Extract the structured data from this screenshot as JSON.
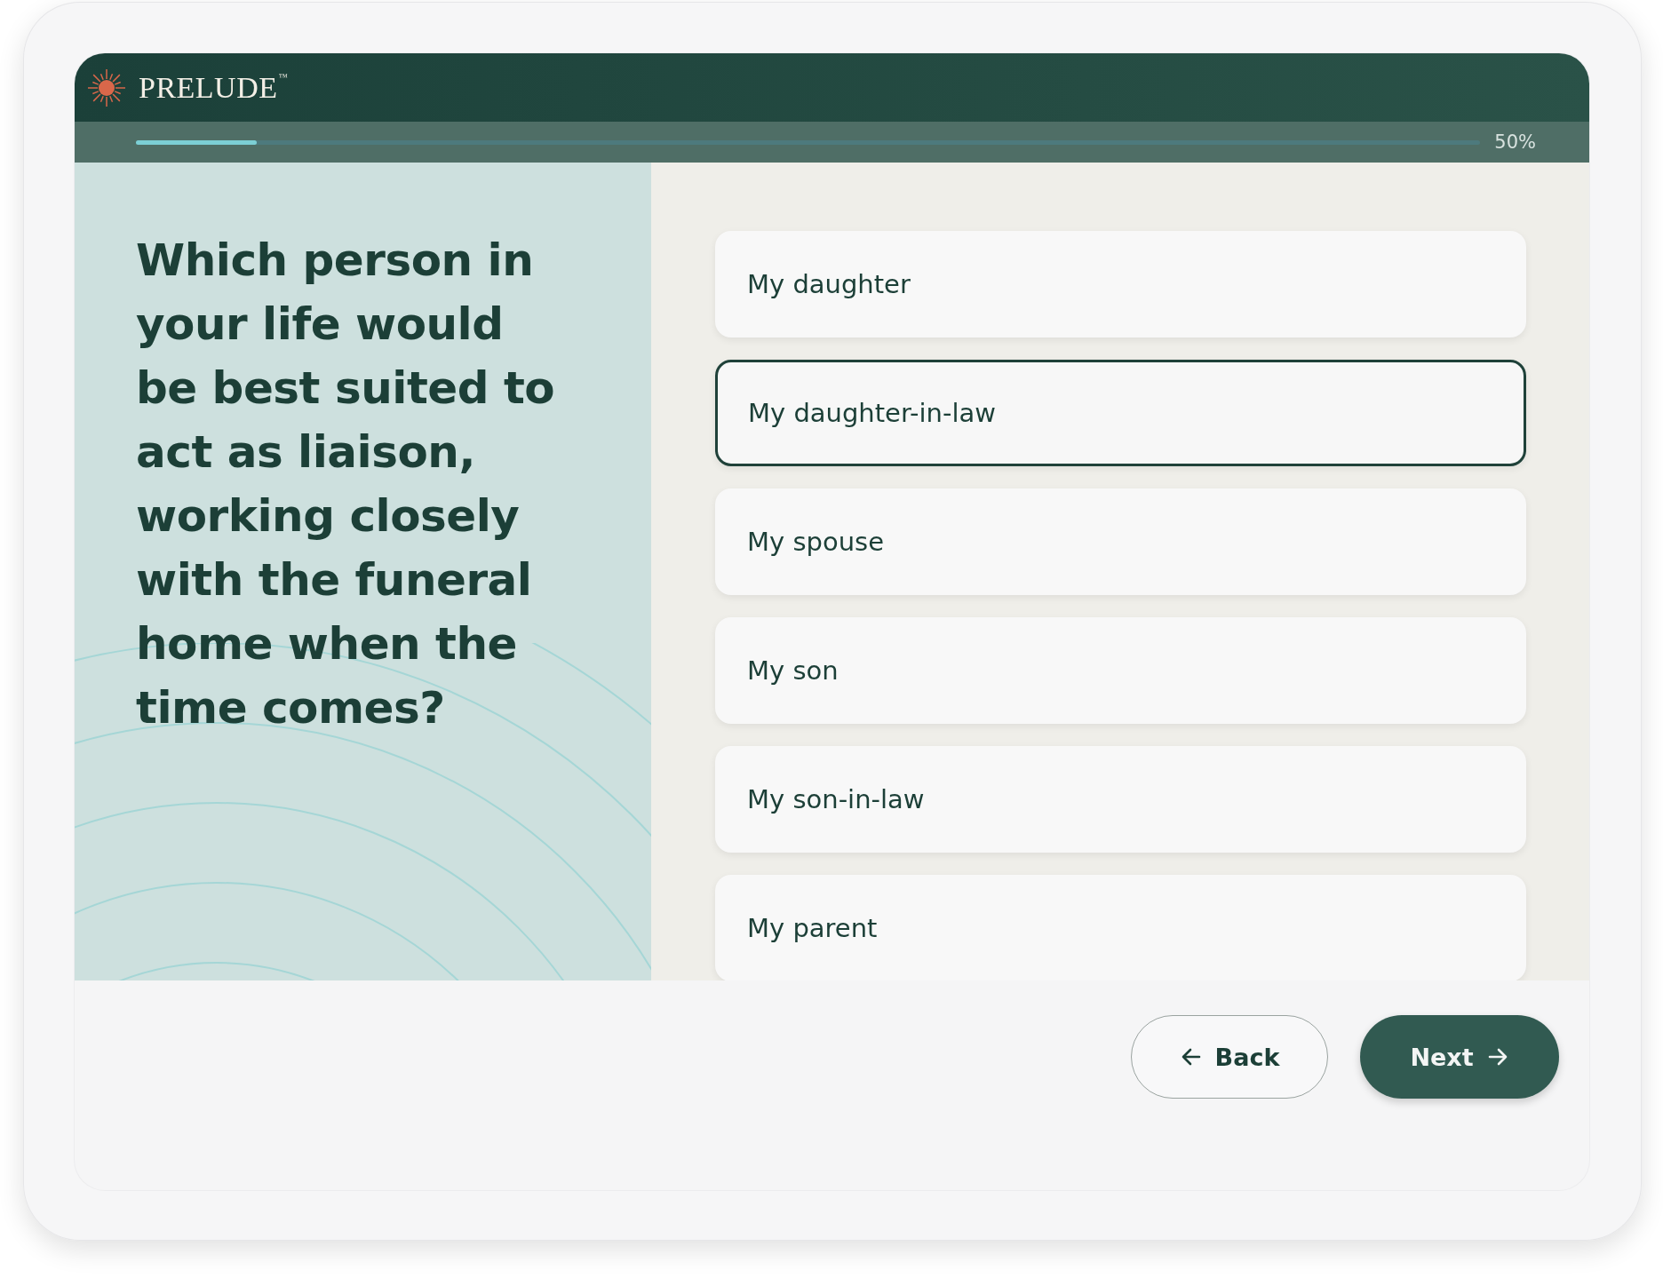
{
  "brand": {
    "name": "PRELUDE",
    "mark": "™"
  },
  "progress": {
    "level": 0.09,
    "reading": "50%"
  },
  "question": "Which person in your life would be best suited to act as liaison, working closely with the funeral home when the time comes?",
  "options": [
    {
      "label": "My daughter",
      "selected": false
    },
    {
      "label": "My daughter-in-law",
      "selected": true
    },
    {
      "label": "My spouse",
      "selected": false
    },
    {
      "label": "My son",
      "selected": false
    },
    {
      "label": "My son-in-law",
      "selected": false
    },
    {
      "label": "My parent",
      "selected": false
    }
  ],
  "buttons": [
    {
      "kind": "back",
      "label": "Back"
    },
    {
      "kind": "next",
      "label": "Next"
    }
  ]
}
